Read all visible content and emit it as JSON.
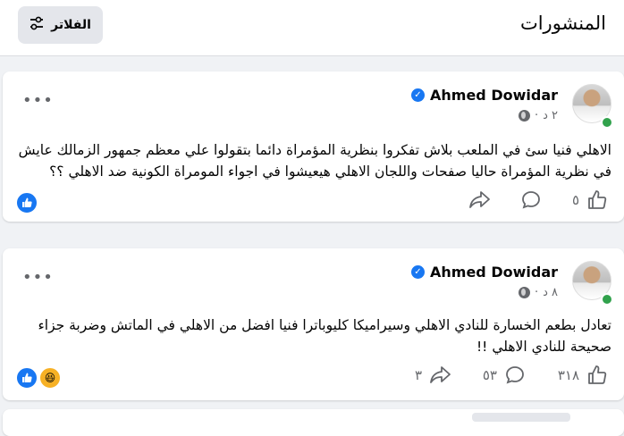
{
  "header": {
    "title": "المنشورات",
    "filters_label": "الفلاتر"
  },
  "posts": [
    {
      "author": "Ahmed Dowidar",
      "time": "٢ د",
      "text": "الاهلي فنيا سئ في الملعب بلاش تفكروا بنظرية المؤمراة دائما بتقولوا علي معظم جمهور الزمالك عايش في نظرية المؤمراة حاليا صفحات واللجان الاهلي هيعيشوا في اجواء المومراة الكونية ضد الاهلي ؟؟",
      "like_count": "٥",
      "comment_count": "",
      "share_count": "",
      "reactions": [
        "like"
      ]
    },
    {
      "author": "Ahmed Dowidar",
      "time": "٨ د",
      "text": "تعادل بطعم الخسارة للنادي الاهلي وسيراميكا كليوباترا فنيا افضل من الاهلي في الماتش وضربة جزاء صحيحة للنادي الاهلي !!",
      "like_count": "٣١٨",
      "comment_count": "٥٣",
      "share_count": "٣",
      "reactions": [
        "like",
        "haha"
      ]
    }
  ],
  "colors": {
    "brand_blue": "#1877f2",
    "online_green": "#31a24c",
    "secondary_text": "#65676b"
  }
}
